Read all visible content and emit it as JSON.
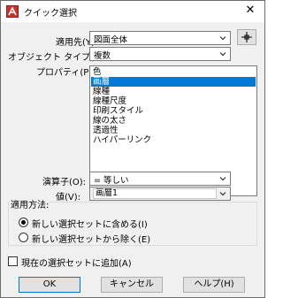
{
  "window": {
    "title": "クイック選択",
    "close_glyph": "✕"
  },
  "form": {
    "apply_to": {
      "label": "適用先(Y):",
      "value": "図面全体"
    },
    "object_type": {
      "label": "オブジェクト タイプ(B):",
      "value": "複数"
    },
    "properties": {
      "label": "プロパティ(P):",
      "items": [
        "色",
        "画層",
        "線種",
        "線種尺度",
        "印刷スタイル",
        "線の太さ",
        "透過性",
        "ハイパーリンク"
      ],
      "selected_index": 1
    },
    "operator": {
      "label": "演算子(O):",
      "value": "= 等しい"
    },
    "value": {
      "label": "値(V):",
      "value": "画層1"
    }
  },
  "apply_method": {
    "title": "適用方法:",
    "include": {
      "label": "新しい選択セットに含める(I)",
      "checked": true
    },
    "exclude": {
      "label": "新しい選択セットから除く(E)",
      "checked": false
    }
  },
  "append": {
    "label": "現在の選択セットに追加(A)",
    "checked": false
  },
  "buttons": {
    "ok": "OK",
    "cancel": "キャンセル",
    "help": "ヘルプ(H)"
  },
  "icons": {
    "app": "autocad-quick-select-icon",
    "dropdown": "chevron-down-icon",
    "select_objects": "select-objects-crosshair-icon"
  }
}
